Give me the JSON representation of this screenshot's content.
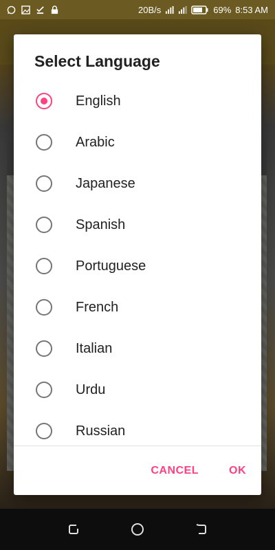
{
  "status_bar": {
    "icons_left": [
      "whatsapp-icon",
      "image-icon",
      "download-done-icon",
      "lock-icon"
    ],
    "network_speed": "20B/s",
    "battery": "69%",
    "time": "8:53 AM"
  },
  "dialog": {
    "title": "Select Language",
    "options": [
      {
        "label": "English",
        "selected": true
      },
      {
        "label": "Arabic",
        "selected": false
      },
      {
        "label": "Japanese",
        "selected": false
      },
      {
        "label": "Spanish",
        "selected": false
      },
      {
        "label": "Portuguese",
        "selected": false
      },
      {
        "label": "French",
        "selected": false
      },
      {
        "label": "Italian",
        "selected": false
      },
      {
        "label": "Urdu",
        "selected": false
      },
      {
        "label": "Russian",
        "selected": false
      }
    ],
    "cancel_label": "CANCEL",
    "ok_label": "OK",
    "accent_color": "#ff4081"
  },
  "nav_bar": {
    "buttons": [
      "recent-apps-icon",
      "home-icon",
      "back-icon"
    ]
  }
}
